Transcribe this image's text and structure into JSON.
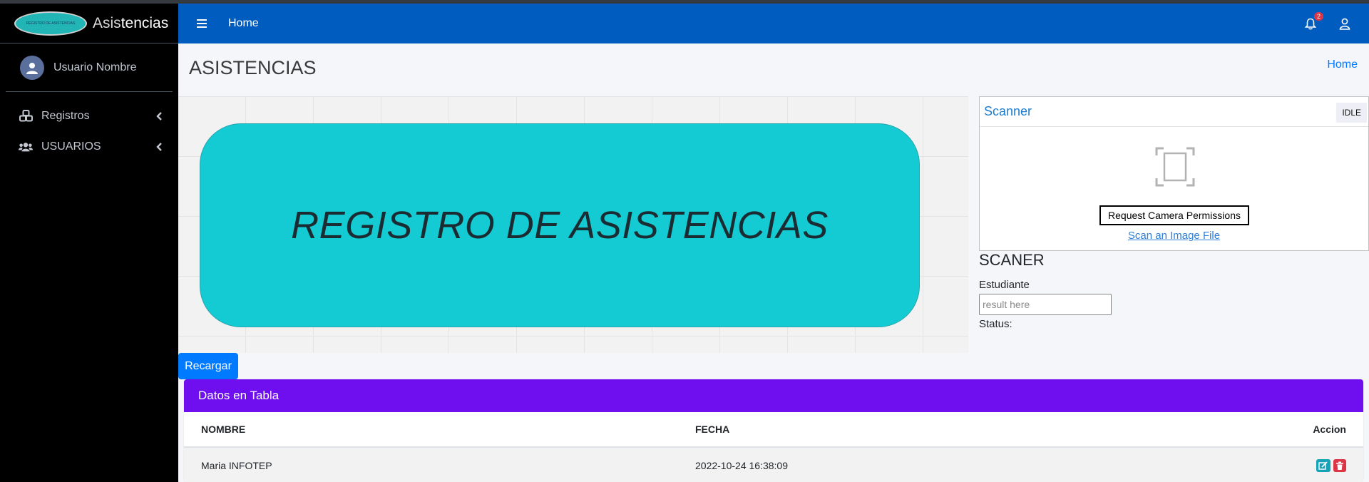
{
  "brand": {
    "logo_text": "REGISTRO DE ASISTENCIAS",
    "title_part1": "Asis",
    "title_part2": "tencias"
  },
  "user": {
    "name": "Usuario Nombre"
  },
  "sidebar": {
    "items": [
      {
        "label": "Registros",
        "icon": "cubes-icon"
      },
      {
        "label": "USUARIOS",
        "icon": "users-icon"
      }
    ]
  },
  "navbar": {
    "home_label": "Home",
    "notifications_count": "2"
  },
  "page": {
    "title": "ASISTENCIAS",
    "breadcrumb": "Home"
  },
  "banner": {
    "text": "REGISTRO DE ASISTENCIAS"
  },
  "scanner": {
    "title": "Scanner",
    "status": "IDLE",
    "request_button": "Request Camera Permissions",
    "scan_file_link": "Scan an Image File"
  },
  "scan_form": {
    "heading": "SCANER",
    "student_label": "Estudiante",
    "result_placeholder": "result here",
    "status_label": "Status:"
  },
  "reload_button": "Recargar",
  "table": {
    "title": "Datos en Tabla",
    "columns": [
      "NOMBRE",
      "FECHA",
      "Accion"
    ],
    "rows": [
      {
        "nombre": "Maria INFOTEP",
        "fecha": "2022-10-24 16:38:09"
      }
    ]
  },
  "colors": {
    "sidebar_bg": "#000000",
    "navbar_bg": "#005cbf",
    "banner_bg": "#14cbd4",
    "table_header_bg": "#6f0ff0",
    "primary": "#007bff"
  }
}
